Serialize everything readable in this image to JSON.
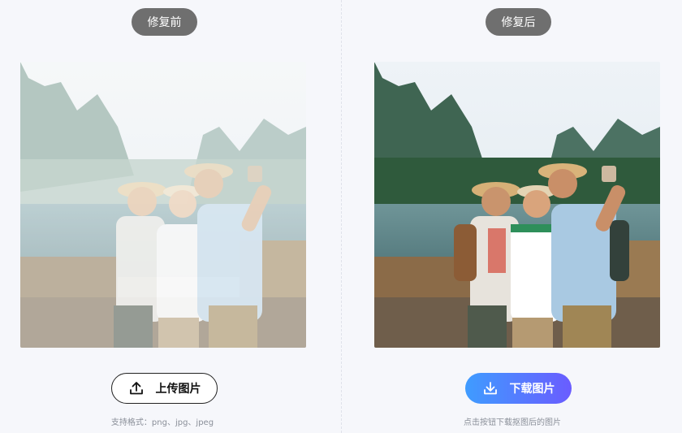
{
  "before": {
    "label": "修复前",
    "upload_button": "上传图片",
    "hint": "支持格式：png、jpg、jpeg"
  },
  "after": {
    "label": "修复后",
    "download_button": "下载图片",
    "hint": "点击按钮下载抠图后的图片"
  },
  "icons": {
    "upload": "upload-icon",
    "download": "download-icon"
  },
  "colors": {
    "download_gradient_start": "#3f9cff",
    "download_gradient_end": "#6a5cff",
    "label_pill": "#6f6f6f"
  }
}
